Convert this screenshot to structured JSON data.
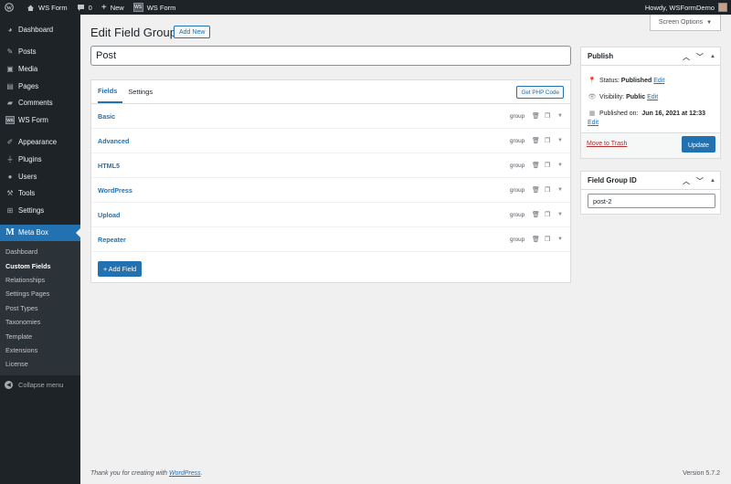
{
  "adminbar": {
    "site_name": "WS Form",
    "comments_count": "0",
    "new_label": "New",
    "plugin_label": "WS Form",
    "greeting": "Howdy, WSFormDemo"
  },
  "sidebar": {
    "items": [
      {
        "label": "Dashboard",
        "icon": "dashboard-icon"
      },
      {
        "label": "Posts",
        "icon": "pin-icon"
      },
      {
        "label": "Media",
        "icon": "media-icon"
      },
      {
        "label": "Pages",
        "icon": "pages-icon"
      },
      {
        "label": "Comments",
        "icon": "comment-icon"
      },
      {
        "label": "WS Form",
        "icon": "wsform-icon"
      },
      {
        "label": "Appearance",
        "icon": "brush-icon"
      },
      {
        "label": "Plugins",
        "icon": "plug-icon"
      },
      {
        "label": "Users",
        "icon": "user-icon"
      },
      {
        "label": "Tools",
        "icon": "wrench-icon"
      },
      {
        "label": "Settings",
        "icon": "settings-icon"
      }
    ],
    "active": {
      "label": "Meta Box",
      "icon_glyph": "M"
    },
    "submenu": [
      "Dashboard",
      "Custom Fields",
      "Relationships",
      "Settings Pages",
      "Post Types",
      "Taxonomies",
      "Template",
      "Extensions",
      "License"
    ],
    "collapse_label": "Collapse menu"
  },
  "screen_options": "Screen Options",
  "page": {
    "title": "Edit Field Group",
    "add_new": "Add New",
    "title_value": "Post"
  },
  "fields_box": {
    "tabs": [
      "Fields",
      "Settings"
    ],
    "php_button": "Get PHP Code",
    "fields": [
      {
        "label": "Basic",
        "type": "group"
      },
      {
        "label": "Advanced",
        "type": "group"
      },
      {
        "label": "HTML5",
        "type": "group"
      },
      {
        "label": "WordPress",
        "type": "group"
      },
      {
        "label": "Upload",
        "type": "group"
      },
      {
        "label": "Repeater",
        "type": "group"
      }
    ],
    "add_field": "+ Add Field"
  },
  "publish": {
    "title": "Publish",
    "status_label": "Status:",
    "status_value": "Published",
    "visibility_label": "Visibility:",
    "visibility_value": "Public",
    "published_label": "Published on:",
    "published_value": "Jun 16, 2021 at 12:33",
    "edit": "Edit",
    "trash": "Move to Trash",
    "update": "Update"
  },
  "group_id": {
    "title": "Field Group ID",
    "value": "post-2"
  },
  "footer": {
    "thanks_prefix": "Thank you for creating with ",
    "thanks_link": "WordPress",
    "thanks_suffix": ".",
    "version": "Version 5.7.2"
  },
  "colors": {
    "accent": "#2271b1",
    "sidebar": "#1d2327",
    "background": "#f0f0f1",
    "danger": "#b32d2e"
  }
}
